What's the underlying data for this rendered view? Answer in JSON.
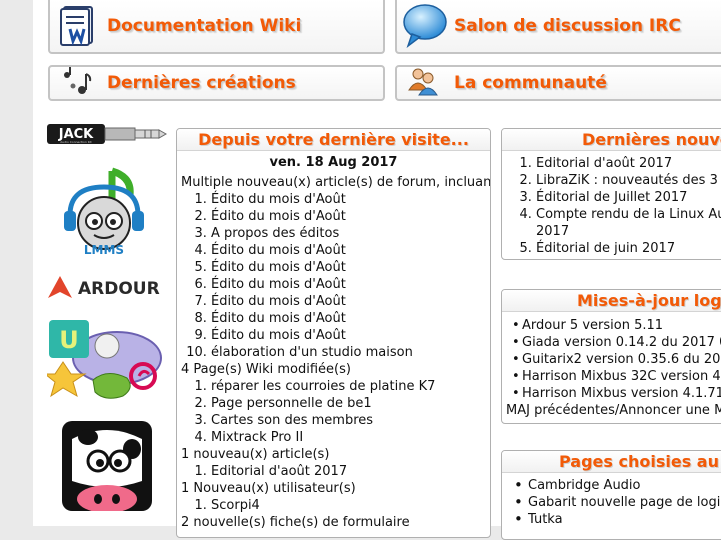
{
  "nav": {
    "wiki": "Documentation Wiki",
    "irc": "Salon de discussion IRC",
    "creations": "Dernières créations",
    "community": "La communauté"
  },
  "logos": {
    "jack": "JACK",
    "jack_sub": "Audio Connection Kit",
    "lmms": "LMMS",
    "ardour": "ARDOUR"
  },
  "since_last": {
    "title": "Depuis votre dernière visite...",
    "date": "ven. 18 Aug 2017",
    "forum_header": "Multiple nouveau(x) article(s) de forum, incluant",
    "forum_items": [
      "Édito du mois d'Août",
      "Édito du mois d'Août",
      "A propos des éditos",
      "Édito du mois d'Août",
      "Édito du mois d'Août",
      "Édito du mois d'Août",
      "Édito du mois d'Août",
      "Édito du mois d'Août",
      "Édito du mois d'Août",
      "élaboration d'un studio maison"
    ],
    "wiki_header": "4 Page(s) Wiki modifiée(s)",
    "wiki_items": [
      "réparer les courroies de platine K7",
      "Page personnelle de be1",
      "Cartes son des membres",
      "Mixtrack Pro II"
    ],
    "article_header": "1 nouveau(x) article(s)",
    "article_items": [
      "Editorial d'août 2017"
    ],
    "user_header": "1 Nouveau(x) utilisateur(s)",
    "user_items": [
      "Scorpi4"
    ],
    "form_header": "2 nouvelle(s) fiche(s) de formulaire"
  },
  "latest_news": {
    "title": "Dernières nouve",
    "items": [
      "Editorial d'août 2017",
      "LibraZiK : nouveautés des 3",
      "Éditorial de Juillet 2017",
      "Compte rendu de la Linux Au",
      "Éditorial de juin 2017"
    ],
    "item4_cont": "2017"
  },
  "updates": {
    "title": "Mises-à-jour logi",
    "items": [
      "Ardour 5 version 5.11",
      "Giada version 0.14.2 du 2017 0",
      "Guitarix2 version 0.35.6 du 201",
      "Harrison Mixbus 32C version 4",
      "Harrison Mixbus version 4.1.71"
    ],
    "footer": "MAJ précédentes/Annoncer une M"
  },
  "chosen": {
    "title": "Pages choisies au",
    "items": [
      "Cambridge Audio",
      "Gabarit nouvelle page de logic",
      "Tutka"
    ]
  },
  "colors": {
    "accent": "#f25a07",
    "border": "#b0b0b0"
  }
}
